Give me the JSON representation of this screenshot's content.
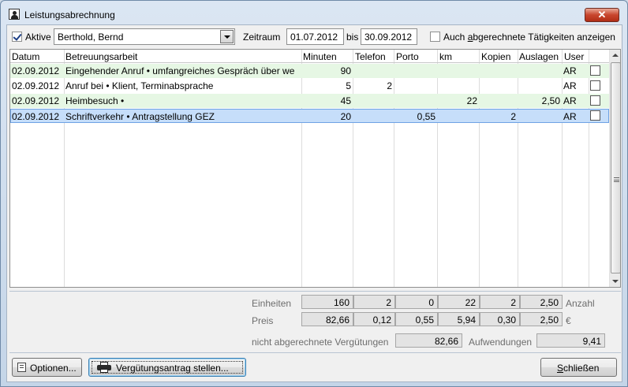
{
  "window": {
    "title": "Leistungsabrechnung",
    "close_label": "✕"
  },
  "filter": {
    "active_label": "Aktive",
    "active_checked": true,
    "person_value": "Berthold, Bernd",
    "period_label": "Zeitraum",
    "date_from": "01.07.2012",
    "to_label": "bis",
    "date_to": "30.09.2012",
    "show_billed_pre": "Auch ",
    "show_billed_accel": "a",
    "show_billed_post": "bgerechnete Tätigkeiten anzeigen",
    "show_billed_checked": false
  },
  "table": {
    "headers": [
      "Datum",
      "Betreuungsarbeit",
      "Minuten",
      "Telefon",
      "Porto",
      "km",
      "Kopien",
      "Auslagen",
      "User"
    ],
    "rows": [
      {
        "datum": "02.09.2012",
        "arbeit": "Eingehender Anruf • umfangreiches Gespräch über we",
        "minuten": "90",
        "telefon": "",
        "porto": "",
        "km": "",
        "kopien": "",
        "auslagen": "",
        "user": "AR"
      },
      {
        "datum": "02.09.2012",
        "arbeit": "Anruf bei • Klient, Terminabsprache",
        "minuten": "5",
        "telefon": "2",
        "porto": "",
        "km": "",
        "kopien": "",
        "auslagen": "",
        "user": "AR"
      },
      {
        "datum": "02.09.2012",
        "arbeit": "Heimbesuch •",
        "minuten": "45",
        "telefon": "",
        "porto": "",
        "km": "22",
        "kopien": "",
        "auslagen": "2,50",
        "user": "AR"
      },
      {
        "datum": "02.09.2012",
        "arbeit": "Schriftverkehr • Antragstellung GEZ",
        "minuten": "20",
        "telefon": "",
        "porto": "0,55",
        "km": "",
        "kopien": "2",
        "auslagen": "",
        "user": "AR"
      }
    ]
  },
  "summary": {
    "einheiten_label": "Einheiten",
    "einheiten": [
      "160",
      "2",
      "0",
      "22",
      "2",
      "2,50"
    ],
    "anzahl_label": "Anzahl",
    "preis_label": "Preis",
    "preis": [
      "82,66",
      "0,12",
      "0,55",
      "5,94",
      "0,30",
      "2,50"
    ],
    "currency": "€",
    "unbilled_label": "nicht abgerechnete Vergütungen",
    "unbilled_value": "82,66",
    "expenses_label": "Aufwendungen",
    "expenses_value": "9,41"
  },
  "buttons": {
    "options": "Optionen...",
    "request": "Vergütungsantrag stellen...",
    "close_accel": "S",
    "close_rest": "chließen"
  },
  "icons": {
    "window": "user-card-icon",
    "options": "options-icon",
    "request": "printer-icon"
  }
}
